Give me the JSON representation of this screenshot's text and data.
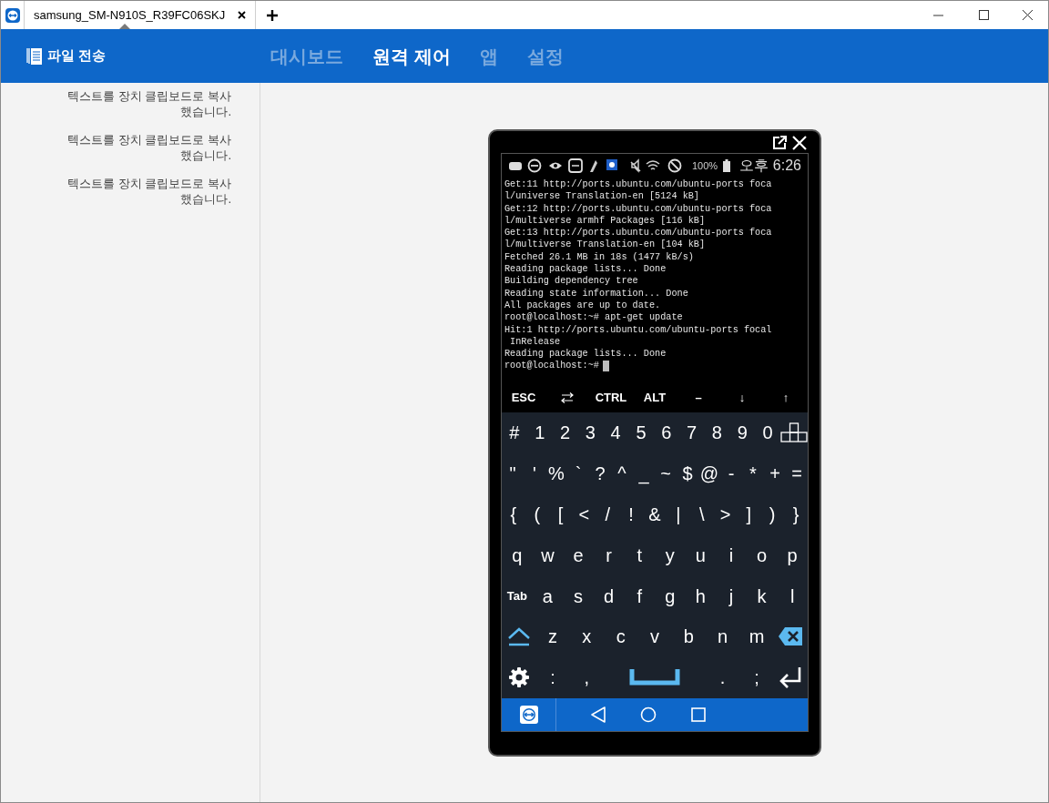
{
  "window": {
    "tabs": [
      {
        "label": "samsung_SM-N910S_R39FC06SKJ",
        "selected": true
      }
    ]
  },
  "header": {
    "file_transfer": "파일 전송",
    "nav": [
      {
        "label": "대시보드",
        "selected": false
      },
      {
        "label": "원격 제어",
        "selected": true
      },
      {
        "label": "앱",
        "selected": false
      },
      {
        "label": "설정",
        "selected": false
      }
    ]
  },
  "sidebar": {
    "messages": [
      "텍스트를 장치 클립보드로 복사 했습니다.",
      "텍스트를 장치 클립보드로 복사 했습니다.",
      "텍스트를 장치 클립보드로 복사 했습니다."
    ]
  },
  "phone": {
    "status_bar": {
      "battery": "100%",
      "time": "오후 6:26"
    },
    "terminal": {
      "lines": [
        "Get:11 http://ports.ubuntu.com/ubuntu-ports foca",
        "l/universe Translation-en [5124 kB]",
        "Get:12 http://ports.ubuntu.com/ubuntu-ports foca",
        "l/multiverse armhf Packages [116 kB]",
        "Get:13 http://ports.ubuntu.com/ubuntu-ports foca",
        "l/multiverse Translation-en [104 kB]",
        "Fetched 26.1 MB in 18s (1477 kB/s)",
        "Reading package lists... Done",
        "Building dependency tree",
        "Reading state information... Done",
        "All packages are up to date.",
        "root@localhost:~# apt-get update",
        "Hit:1 http://ports.ubuntu.com/ubuntu-ports focal",
        " InRelease",
        "Reading package lists... Done"
      ],
      "prompt": "root@localhost:~#"
    },
    "extra_keys": [
      {
        "kind": "text",
        "label": "ESC"
      },
      {
        "kind": "swap"
      },
      {
        "kind": "text",
        "label": "CTRL"
      },
      {
        "kind": "text",
        "label": "ALT"
      },
      {
        "kind": "text",
        "label": "–"
      },
      {
        "kind": "text",
        "label": "↓"
      },
      {
        "kind": "text",
        "label": "↑"
      }
    ],
    "keyboard": [
      [
        {
          "kind": "text",
          "label": "#"
        },
        {
          "kind": "text",
          "label": "1"
        },
        {
          "kind": "text",
          "label": "2"
        },
        {
          "kind": "text",
          "label": "3"
        },
        {
          "kind": "text",
          "label": "4"
        },
        {
          "kind": "text",
          "label": "5"
        },
        {
          "kind": "text",
          "label": "6"
        },
        {
          "kind": "text",
          "label": "7"
        },
        {
          "kind": "text",
          "label": "8"
        },
        {
          "kind": "text",
          "label": "9"
        },
        {
          "kind": "text",
          "label": "0"
        },
        {
          "kind": "arrows"
        }
      ],
      [
        {
          "kind": "text",
          "label": "\""
        },
        {
          "kind": "text",
          "label": "'"
        },
        {
          "kind": "text",
          "label": "%"
        },
        {
          "kind": "text",
          "label": "`"
        },
        {
          "kind": "text",
          "label": "?"
        },
        {
          "kind": "text",
          "label": "^"
        },
        {
          "kind": "text",
          "label": "_"
        },
        {
          "kind": "text",
          "label": "~"
        },
        {
          "kind": "text",
          "label": "$"
        },
        {
          "kind": "text",
          "label": "@"
        },
        {
          "kind": "text",
          "label": "-"
        },
        {
          "kind": "text",
          "label": "*"
        },
        {
          "kind": "text",
          "label": "+"
        },
        {
          "kind": "text",
          "label": "="
        }
      ],
      [
        {
          "kind": "text",
          "label": "{"
        },
        {
          "kind": "text",
          "label": "("
        },
        {
          "kind": "text",
          "label": "["
        },
        {
          "kind": "text",
          "label": "<"
        },
        {
          "kind": "text",
          "label": "/"
        },
        {
          "kind": "text",
          "label": "!"
        },
        {
          "kind": "text",
          "label": "&"
        },
        {
          "kind": "text",
          "label": "|"
        },
        {
          "kind": "text",
          "label": "\\"
        },
        {
          "kind": "text",
          "label": ">"
        },
        {
          "kind": "text",
          "label": "]"
        },
        {
          "kind": "text",
          "label": ")"
        },
        {
          "kind": "text",
          "label": "}"
        }
      ],
      [
        {
          "kind": "text",
          "label": "q"
        },
        {
          "kind": "text",
          "label": "w"
        },
        {
          "kind": "text",
          "label": "e"
        },
        {
          "kind": "text",
          "label": "r"
        },
        {
          "kind": "text",
          "label": "t"
        },
        {
          "kind": "text",
          "label": "y"
        },
        {
          "kind": "text",
          "label": "u"
        },
        {
          "kind": "text",
          "label": "i"
        },
        {
          "kind": "text",
          "label": "o"
        },
        {
          "kind": "text",
          "label": "p"
        }
      ],
      [
        {
          "kind": "small",
          "label": "Tab"
        },
        {
          "kind": "text",
          "label": "a"
        },
        {
          "kind": "text",
          "label": "s"
        },
        {
          "kind": "text",
          "label": "d"
        },
        {
          "kind": "text",
          "label": "f"
        },
        {
          "kind": "text",
          "label": "g"
        },
        {
          "kind": "text",
          "label": "h"
        },
        {
          "kind": "text",
          "label": "j"
        },
        {
          "kind": "text",
          "label": "k"
        },
        {
          "kind": "text",
          "label": "l"
        }
      ],
      [
        {
          "kind": "shift"
        },
        {
          "kind": "text",
          "label": "z"
        },
        {
          "kind": "text",
          "label": "x"
        },
        {
          "kind": "text",
          "label": "c"
        },
        {
          "kind": "text",
          "label": "v"
        },
        {
          "kind": "text",
          "label": "b"
        },
        {
          "kind": "text",
          "label": "n"
        },
        {
          "kind": "text",
          "label": "m"
        },
        {
          "kind": "backspace"
        }
      ],
      [
        {
          "kind": "settings"
        },
        {
          "kind": "text",
          "label": ":"
        },
        {
          "kind": "text",
          "label": ","
        },
        {
          "kind": "space"
        },
        {
          "kind": "text",
          "label": "."
        },
        {
          "kind": "text",
          "label": ";"
        },
        {
          "kind": "enter"
        }
      ]
    ]
  }
}
